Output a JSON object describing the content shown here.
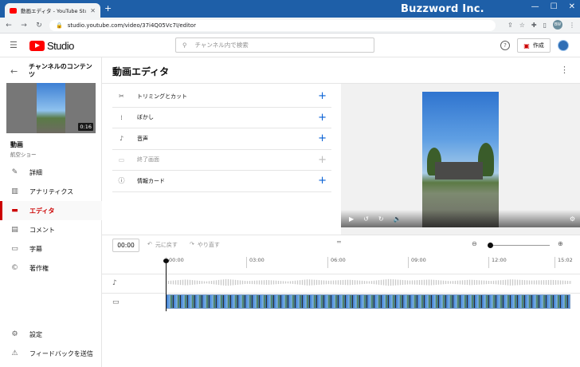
{
  "browser": {
    "tab_title": "動画エディタ - YouTube Studio",
    "url": "studio.youtube.com/video/37i4Q05Vc7I/editor",
    "brand": "Buzzword Inc.",
    "profile_initials": "BW"
  },
  "header": {
    "logo_text": "Studio",
    "search_placeholder": "チャンネル内で検索",
    "create_label": "作成"
  },
  "sidebar": {
    "content_title": "チャンネルのコンテンツ",
    "thumb_duration": "0:16",
    "video_title": "動画",
    "video_subtitle": "航空ショー",
    "items": [
      {
        "label": "詳細",
        "icon": "pencil-icon"
      },
      {
        "label": "アナリティクス",
        "icon": "analytics-icon"
      },
      {
        "label": "エディタ",
        "icon": "editor-icon",
        "active": true
      },
      {
        "label": "コメント",
        "icon": "comment-icon"
      },
      {
        "label": "字幕",
        "icon": "subtitles-icon"
      },
      {
        "label": "著作権",
        "icon": "copyright-icon"
      }
    ],
    "bottom_items": [
      {
        "label": "設定",
        "icon": "settings-icon"
      },
      {
        "label": "フィードバックを送信",
        "icon": "feedback-icon"
      }
    ]
  },
  "main": {
    "page_title": "動画エディタ",
    "tools": [
      {
        "label": "トリミングとカット",
        "icon": "scissors-icon"
      },
      {
        "label": "ぼかし",
        "icon": "blur-icon"
      },
      {
        "label": "音声",
        "icon": "music-note-icon"
      },
      {
        "label": "終了画面",
        "icon": "end-screen-icon",
        "disabled": true
      },
      {
        "label": "情報カード",
        "icon": "info-icon"
      }
    ]
  },
  "timeline": {
    "current_time": "00:00",
    "undo_label": "元に戻す",
    "redo_label": "やり直す",
    "ticks": [
      "00:00",
      "03:00",
      "06:00",
      "09:00",
      "12:00",
      "15:02"
    ],
    "zoom_level": 0
  },
  "colors": {
    "accent_red": "#cc0000",
    "link_blue": "#065fd4",
    "titlebar": "#1e5fa8"
  }
}
